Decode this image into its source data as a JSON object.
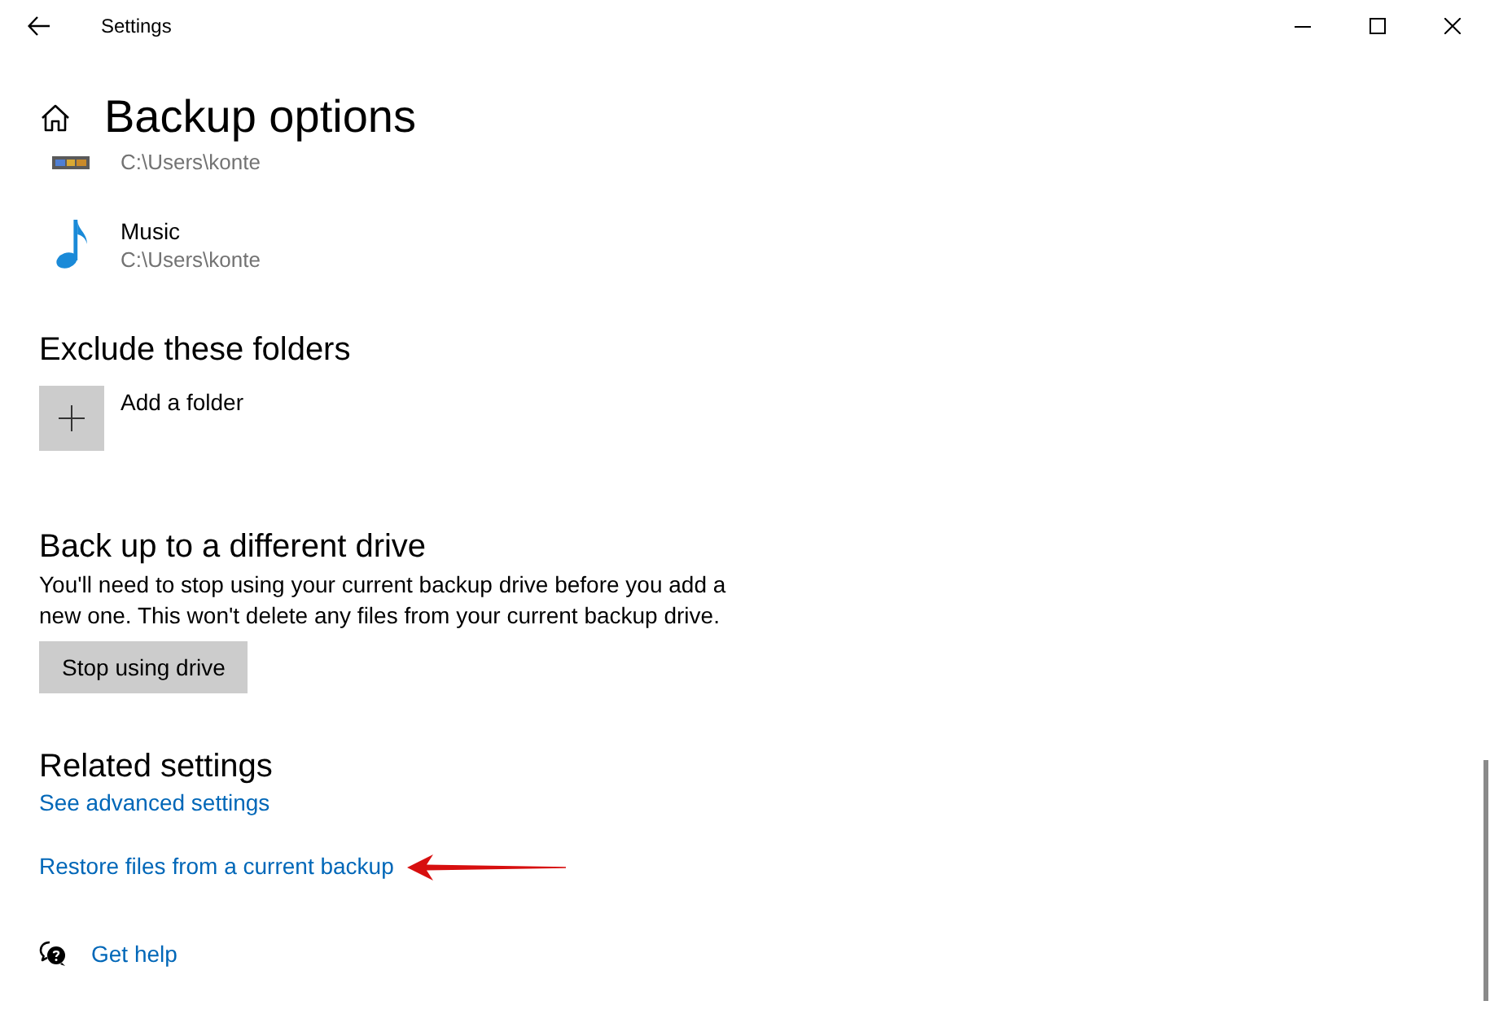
{
  "window": {
    "title": "Settings"
  },
  "page": {
    "title": "Backup options"
  },
  "folders": [
    {
      "kind": "video",
      "path": "C:\\Users\\konte"
    },
    {
      "kind": "music",
      "name": "Music",
      "path": "C:\\Users\\konte"
    }
  ],
  "exclude": {
    "heading": "Exclude these folders",
    "add_label": "Add a folder"
  },
  "different_drive": {
    "heading": "Back up to a different drive",
    "description": "You'll need to stop using your current backup drive before you add a new one. This won't delete any files from your current backup drive.",
    "button": "Stop using drive"
  },
  "related": {
    "heading": "Related settings",
    "links": [
      {
        "label": "See advanced settings",
        "pointed_at": false
      },
      {
        "label": "Restore files from a current backup",
        "pointed_at": true
      }
    ]
  },
  "help": {
    "label": "Get help"
  }
}
